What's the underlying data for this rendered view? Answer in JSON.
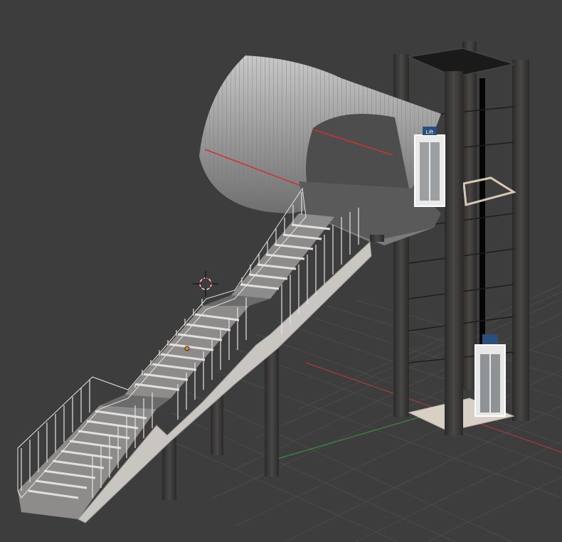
{
  "viewport": {
    "background": "#3d3d3d",
    "grid_color": "#4a4a4a",
    "axis_x_color": "#a63c3c",
    "axis_y_color": "#3c8a3c"
  },
  "scene_objects": [
    {
      "name": "cylindrical-walkway-tunnel",
      "color": "#9a9a9a"
    },
    {
      "name": "stairs",
      "color": "#b0b0b0"
    },
    {
      "name": "elevator-tower",
      "color": "#2e2e2e"
    },
    {
      "name": "elevator-car-top",
      "color": "#ffffff"
    },
    {
      "name": "elevator-car-bottom",
      "color": "#ffffff"
    }
  ],
  "signs": {
    "elevator_top": "Lift",
    "elevator_bottom": ""
  },
  "icons": [
    "3d-cursor-icon",
    "origin-dot-icon"
  ]
}
